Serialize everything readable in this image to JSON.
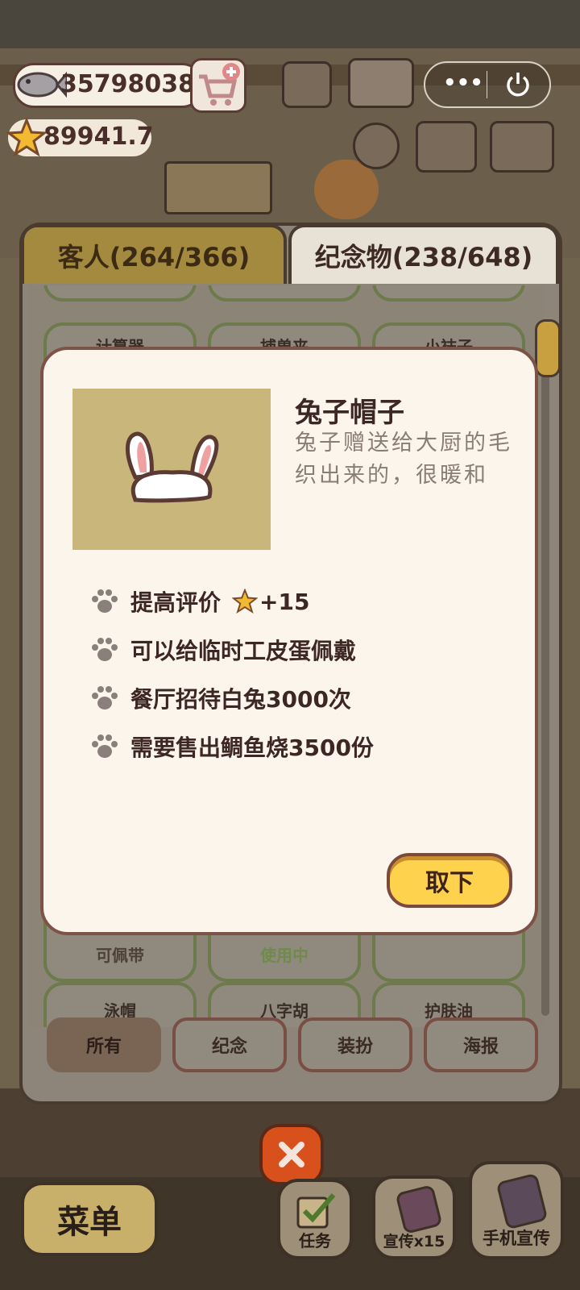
{
  "hud": {
    "fish_count": "35798038",
    "star_rating": "89941.7"
  },
  "tabs": {
    "guests_label": "客人(264/366)",
    "souvenirs_label": "纪念物(238/648)"
  },
  "grid": {
    "row_top": [
      "计算器",
      "捕兽夹",
      "小袜子"
    ],
    "row_mid": [
      {
        "status": "可佩带",
        "status_color": "#4e4038"
      },
      {
        "status": "使用中",
        "status_color": "#6f8a4a"
      },
      {
        "status": "",
        "status_color": "#4e4038"
      }
    ],
    "row_bottom": [
      "泳帽",
      "八字胡",
      "护肤油"
    ]
  },
  "filters": [
    "所有",
    "纪念",
    "装扮",
    "海报"
  ],
  "modal": {
    "item_name": "兔子帽子",
    "item_desc": "兔子赠送给大厨的毛织出来的，很暖和",
    "perks": [
      {
        "text": "提高评价",
        "bonus": "+15"
      },
      {
        "text": "可以给临时工皮蛋佩戴"
      },
      {
        "text": "餐厅招待白兔3000次"
      },
      {
        "text": "需要售出鲷鱼烧3500份"
      }
    ],
    "remove_label": "取下"
  },
  "bottom_bar": {
    "menu_label": "菜单",
    "tasks_label": "任务",
    "promo_label": "宣传x15",
    "phone_promo_label": "手机宣传"
  },
  "colors": {
    "accent_yellow": "#ffd24e",
    "panel_border": "#4a3b30",
    "tab_gold": "#a48a3e",
    "modal_bg": "#fcf5eb"
  }
}
